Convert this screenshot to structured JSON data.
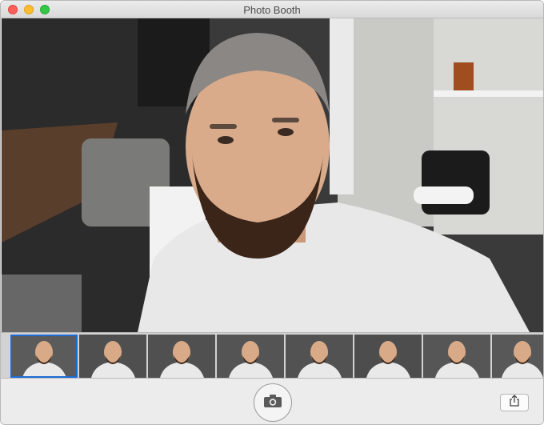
{
  "window": {
    "title": "Photo Booth"
  },
  "preview": {
    "subject": "camera-live-view"
  },
  "thumbnails": [
    {
      "selected": true
    },
    {
      "selected": false
    },
    {
      "selected": false
    },
    {
      "selected": false
    },
    {
      "selected": false
    },
    {
      "selected": false
    },
    {
      "selected": false
    },
    {
      "selected": false
    }
  ],
  "toolbar": {
    "shutter_icon": "camera-icon",
    "share_icon": "share-icon"
  },
  "colors": {
    "close": "#fc5f57",
    "minimize": "#fdbc2e",
    "zoom": "#33c748",
    "selection": "#1f6bd6"
  }
}
